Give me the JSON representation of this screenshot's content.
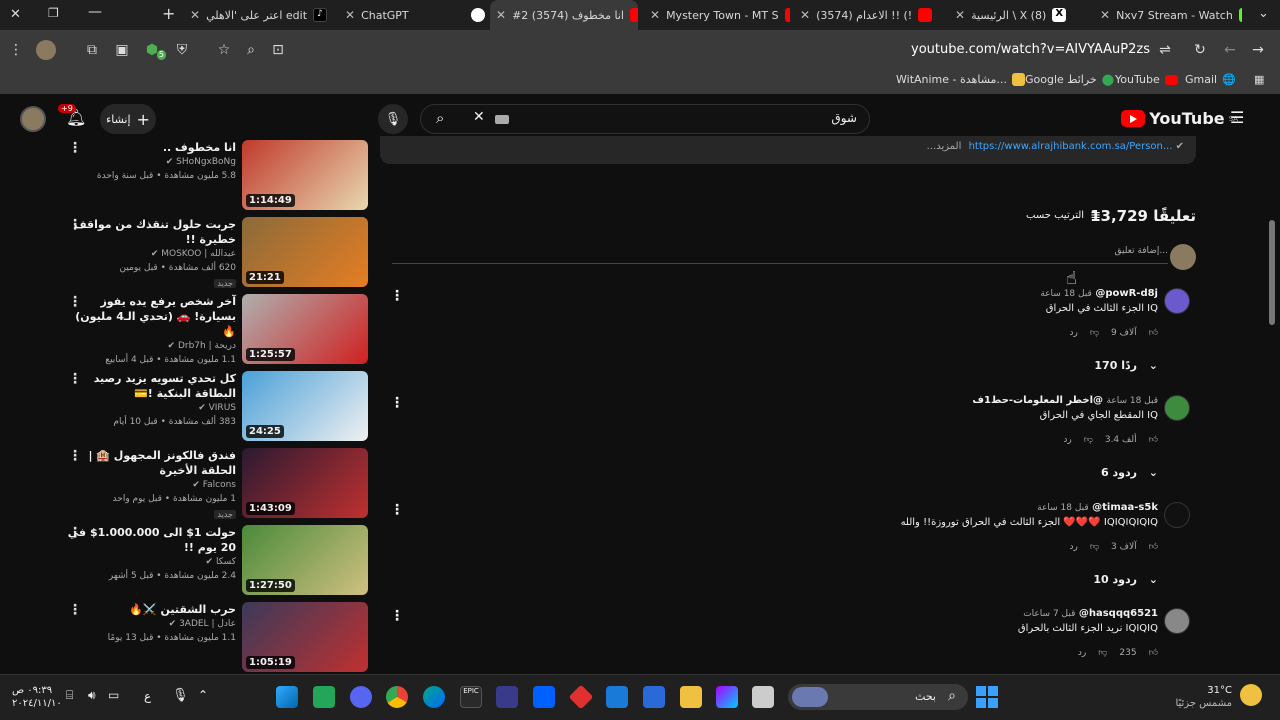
{
  "browser": {
    "tabs": [
      {
        "title": "اعتر على 'الاهلي edit",
        "icon": "tiktok-icon"
      },
      {
        "title": "ChatGPT",
        "icon": "chatgpt-icon"
      },
      {
        "title": "#2 انا مخطوف (3574)",
        "icon": "youtube-icon"
      },
      {
        "title": "Mystery Town - MT S",
        "icon": "youtube-icon"
      },
      {
        "title": "(3574) الاعدام !! (!",
        "icon": "youtube-icon"
      },
      {
        "title": "الرئيسية \\ X (8)",
        "icon": "x-icon"
      },
      {
        "title": "Nxv7 Stream - Watch",
        "icon": "kick-icon"
      }
    ],
    "url": "youtube.com/watch?v=AIVYAAuP2zs",
    "extension_badge": "5",
    "bookmarks": [
      "WitAnime - مشاهدة...",
      "Google خرائط",
      "YouTube",
      "Gmail"
    ]
  },
  "youtube": {
    "logo": "YouTube",
    "region": "SA",
    "search_query": "شوق",
    "create_label": "إنشاء",
    "notification_count": "+9"
  },
  "description_link": "https://www.alrajhibank.com.sa/Person...",
  "description_more": "...المزيد",
  "comments_header": {
    "count": "13,729 تعليقًا",
    "sort": "الترتيب حسب",
    "add_placeholder": "إضافة تعليق..."
  },
  "comments": [
    {
      "author": "@powR-d8j",
      "time": "قبل 18 ساعة",
      "text": "الجزء الثالث في الحراق IQ",
      "likes": "9 آلاف",
      "reply": "رد",
      "replies": "170 ردًا",
      "avatar_color": "#6a5acd"
    },
    {
      "author": "@اخطر المعلومات-حط1ف",
      "time": "قبل 18 ساعة",
      "text": "المقطع الجاي في الحراق IQ",
      "likes": "3.4 ألف",
      "reply": "رد",
      "replies": "6 ردود",
      "avatar_color": "#3d8b3d"
    },
    {
      "author": "@timaa-s5k",
      "time": "قبل 18 ساعة",
      "text": "الجزء الثالث في الحراق توروزة!! والله ❤️❤️❤️ IQIQIQIQIQ",
      "likes": "3 آلاف",
      "reply": "رد",
      "replies": "10 ردود",
      "avatar_color": "#111111"
    },
    {
      "author": "@hasqqq6521",
      "time": "قبل 7 ساعات",
      "text": "نريد الجزء الثالث بالحراق IQIQIQ",
      "likes": "235",
      "reply": "رد",
      "replies": "",
      "avatar_color": "#888888"
    }
  ],
  "videos": [
    {
      "title": "انا مخطوف ..",
      "channel": "SHoNgxBoNg",
      "meta": "5.8 مليون مشاهدة • قبل سنة واحدة",
      "duration": "1:14:49",
      "new": "",
      "colors": [
        "#c0392b",
        "#e8d8b0"
      ]
    },
    {
      "title": "جربت حلول تنقذك من مواقف خطيرة !!",
      "channel": "عبدالله | MOSKOO",
      "meta": "620 ألف مشاهدة • قبل يومين",
      "duration": "21:21",
      "new": "جديد",
      "colors": [
        "#8a6a3a",
        "#e67e22"
      ]
    },
    {
      "title": "آخر شخص يرفع يده يفوز بسيارة! 🚗 (تحدي الـ4 مليون) 🔥",
      "channel": "دريحة | Drb7h",
      "meta": "1.1 مليون مشاهدة • قبل 4 أسابيع",
      "duration": "1:25:57",
      "new": "",
      "colors": [
        "#b0b0b0",
        "#d02020"
      ]
    },
    {
      "title": "كل تحدي تسويه يزيد رصيد البطاقة البنكية !💳",
      "channel": "VIRUS",
      "meta": "383 ألف مشاهدة • قبل 10 أيام",
      "duration": "24:25",
      "new": "",
      "colors": [
        "#4aa0d8",
        "#f0f0f0"
      ]
    },
    {
      "title": "فندق فالكونز المجهول 🏨 | الحلقة الأخيرة",
      "channel": "Falcons",
      "meta": "1 مليون مشاهدة • قبل يوم واحد",
      "duration": "1:43:09",
      "new": "جديد",
      "colors": [
        "#2a1a30",
        "#c03030"
      ]
    },
    {
      "title": "حولت 1$ الى 1.000.000$ في 20 يوم !!",
      "channel": "كسكا",
      "meta": "2.4 مليون مشاهدة • قبل 5 أشهر",
      "duration": "1:27:50",
      "new": "",
      "colors": [
        "#4a8a3a",
        "#d0c080"
      ]
    },
    {
      "title": "حرب الشقتين ⚔️🔥",
      "channel": "عادل | 3ADEL",
      "meta": "1.1 مليون مشاهدة • قبل 13 يومًا",
      "duration": "1:05:19",
      "new": "",
      "colors": [
        "#3a3a5a",
        "#c03030"
      ]
    }
  ],
  "taskbar": {
    "search": "بحث",
    "weather_temp": "31°C",
    "weather_desc": "مشمس جزئيًا",
    "time": "٠٩:٣٩ ص",
    "date": "٢٠٢٤/١١/١٠",
    "lang": "ع"
  }
}
